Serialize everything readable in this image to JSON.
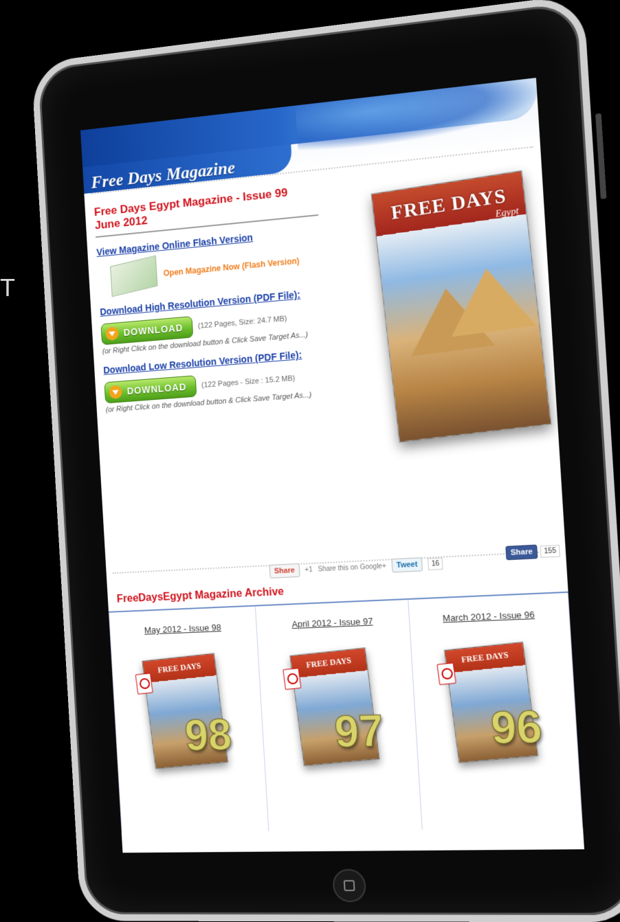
{
  "edge_glyph": "T",
  "site": {
    "title": "Free Days Magazine"
  },
  "issue": {
    "heading": "Free Days Egypt Magazine - Issue 99 June 2012",
    "view_online_label": "View Magazine Online Flash Version",
    "open_flash_label": "Open Magazine Now (Flash Version)",
    "download_high_label": "Download High Resolution Version (PDF File):",
    "download_high_meta": "(122 Pages, Size: 24.7 MB)",
    "download_high_note": "(or Right Click on the download button & Click Save Target As...)",
    "download_low_label": "Download Low Resolution Version (PDF File):",
    "download_low_meta": "(122 Pages - Size : 15.2 MB)",
    "download_low_note": "(or Right Click on the download button & Click Save Target As...)",
    "download_button_label": "DOWNLOAD"
  },
  "cover": {
    "title": "FREE DAYS",
    "subtitle": "Egypt"
  },
  "share": {
    "gplus_label": "Share",
    "gplus_count": "+1",
    "gplus_text": "Share this on Google+",
    "tweet_label": "Tweet",
    "tweet_count": "16",
    "fb_label": "Share",
    "fb_count": "155"
  },
  "archive": {
    "heading": "FreeDaysEgypt Magazine Archive",
    "items": [
      {
        "label": "May 2012 - Issue 98",
        "number": "98",
        "cover_title": "FREE DAYS"
      },
      {
        "label": "April 2012 - Issue 97",
        "number": "97",
        "cover_title": "FREE DAYS"
      },
      {
        "label": "March 2012 - Issue 96",
        "number": "96",
        "cover_title": "FREE DAYS"
      }
    ]
  },
  "colors": {
    "heading_red": "#d1121b",
    "link_blue": "#1a3fa8",
    "download_green": "#6cbf2c",
    "flash_orange": "#f07d1d",
    "header_blue": "#1348a8"
  }
}
